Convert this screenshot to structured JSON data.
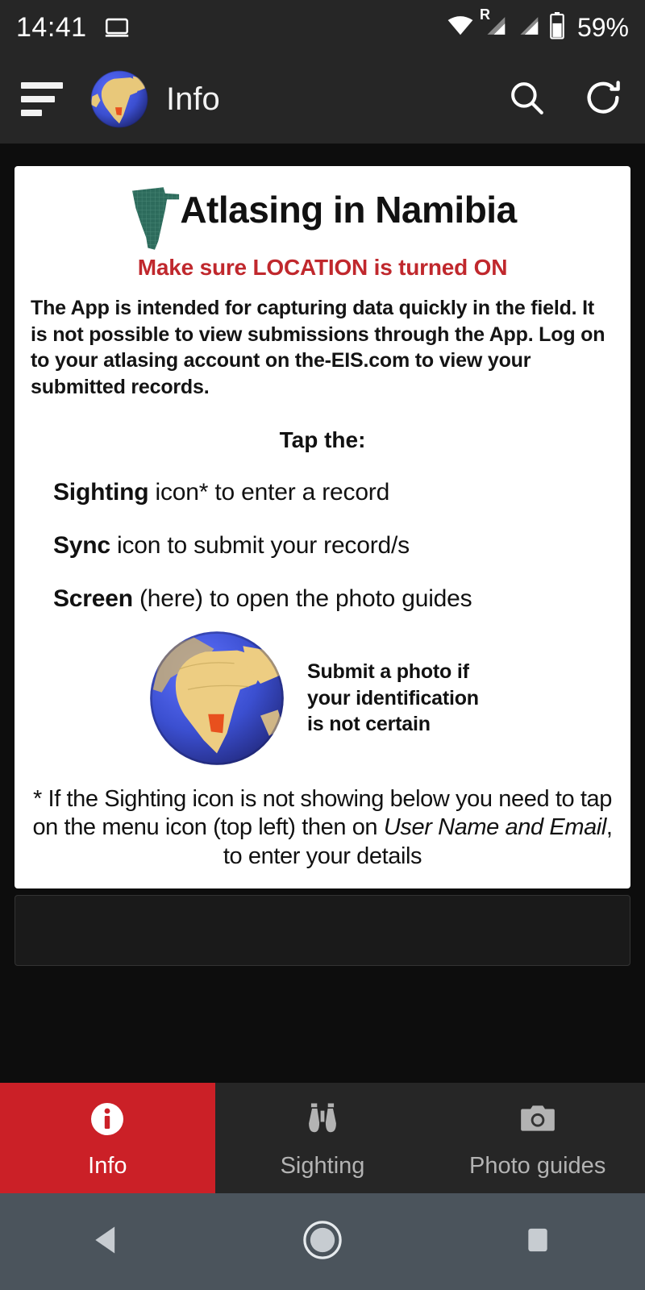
{
  "status_bar": {
    "time": "14:41",
    "battery_percent": "59%",
    "icons": [
      "cast-icon",
      "wifi-icon",
      "signal-roaming-icon",
      "signal-icon",
      "battery-icon"
    ],
    "roaming_label": "R"
  },
  "app_bar": {
    "title": "Info",
    "menu_icon": "menu-icon",
    "logo_icon": "globe-icon",
    "actions": [
      {
        "name": "search-icon",
        "label": "Search"
      },
      {
        "name": "refresh-icon",
        "label": "Refresh"
      }
    ]
  },
  "card": {
    "title": "Atlasing in Namibia",
    "map_icon": "namibia-map-icon",
    "warning": "Make sure LOCATION is turned ON",
    "paragraph": "The App is intended for capturing data quickly in the field. It is not possible to view submissions through the App. Log on to your atlasing account on the-EIS.com to view your submitted records.",
    "tap_heading": "Tap the:",
    "instructions": [
      {
        "bold": "Sighting",
        "rest": " icon* to enter a record"
      },
      {
        "bold": "Sync",
        "rest": " icon to submit your record/s"
      },
      {
        "bold": "Screen",
        "rest": " (here) to open the photo guides"
      }
    ],
    "globe_note": "Submit a photo if your identification is not certain",
    "footnote_before": "* If the Sighting icon is not showing below you need to tap on the menu icon (top left) then on ",
    "footnote_italic": "User Name and Email",
    "footnote_after": ", to enter your details"
  },
  "bottom_nav": {
    "active_index": 0,
    "tabs": [
      {
        "label": "Info",
        "icon": "info-circle-icon"
      },
      {
        "label": "Sighting",
        "icon": "binoculars-icon"
      },
      {
        "label": "Photo guides",
        "icon": "camera-icon"
      }
    ]
  },
  "android_nav": {
    "buttons": [
      {
        "name": "back-button",
        "icon": "triangle-left-icon"
      },
      {
        "name": "home-button",
        "icon": "circle-icon"
      },
      {
        "name": "recents-button",
        "icon": "square-icon"
      }
    ]
  },
  "colors": {
    "accent_red": "#cb2027",
    "warning_red": "#c0282d",
    "bar_dark": "#262626",
    "background": "#0d0d0d",
    "nav_bar": "#4b545c",
    "map_teal": "#2d6b5c",
    "globe_ocean": "#3b4fd0",
    "globe_land": "#e8c87a",
    "globe_namibia": "#e8501e"
  }
}
